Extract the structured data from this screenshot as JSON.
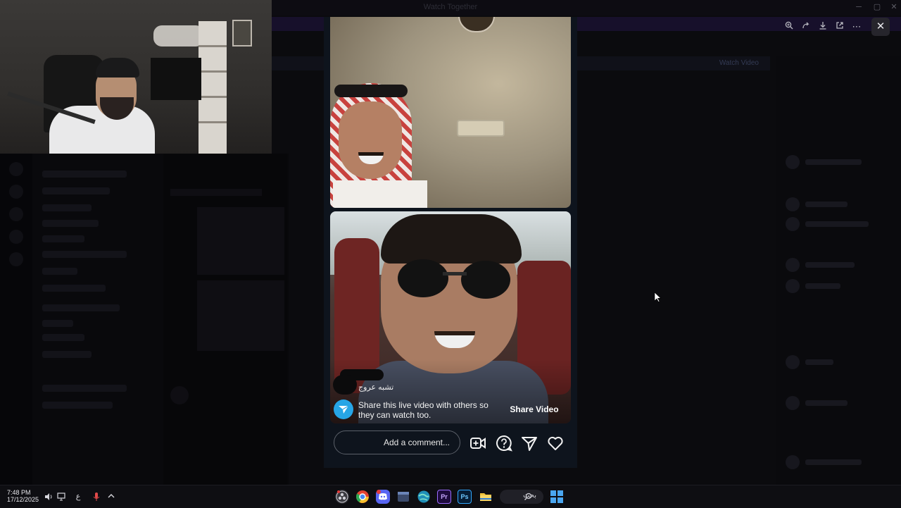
{
  "window": {
    "title": "Watch Together"
  },
  "background_app": {
    "banner_label": "Watch Video",
    "channels": [
      "",
      "",
      "",
      "",
      "",
      "",
      "",
      "",
      "",
      "",
      "",
      "",
      "",
      ""
    ]
  },
  "viewer": {
    "toolbar": {
      "zoom_icon": "zoom-in-icon",
      "forward_icon": "forward-icon",
      "download_icon": "download-icon",
      "open_icon": "open-external-icon",
      "more_icon": "more-icon",
      "close_label": "✕"
    },
    "live": {
      "username": "تشبه عروج",
      "share_text": "Share this live video with others so they can watch too.",
      "share_button": "Share Video",
      "comment_placeholder": "Add a comment...",
      "actions": [
        "add-video-icon",
        "question-icon",
        "send-icon",
        "heart-icon"
      ],
      "accent": "#27a5e6"
    }
  },
  "taskbar": {
    "time": "7:48 PM",
    "date": "17/12/2025",
    "language": "ع",
    "search_label": "بحث",
    "apps": [
      "obs-icon",
      "chrome-icon",
      "discord-icon",
      "terminal-icon",
      "browser-icon",
      "premiere-icon",
      "photoshop-icon",
      "file-explorer-icon"
    ]
  }
}
